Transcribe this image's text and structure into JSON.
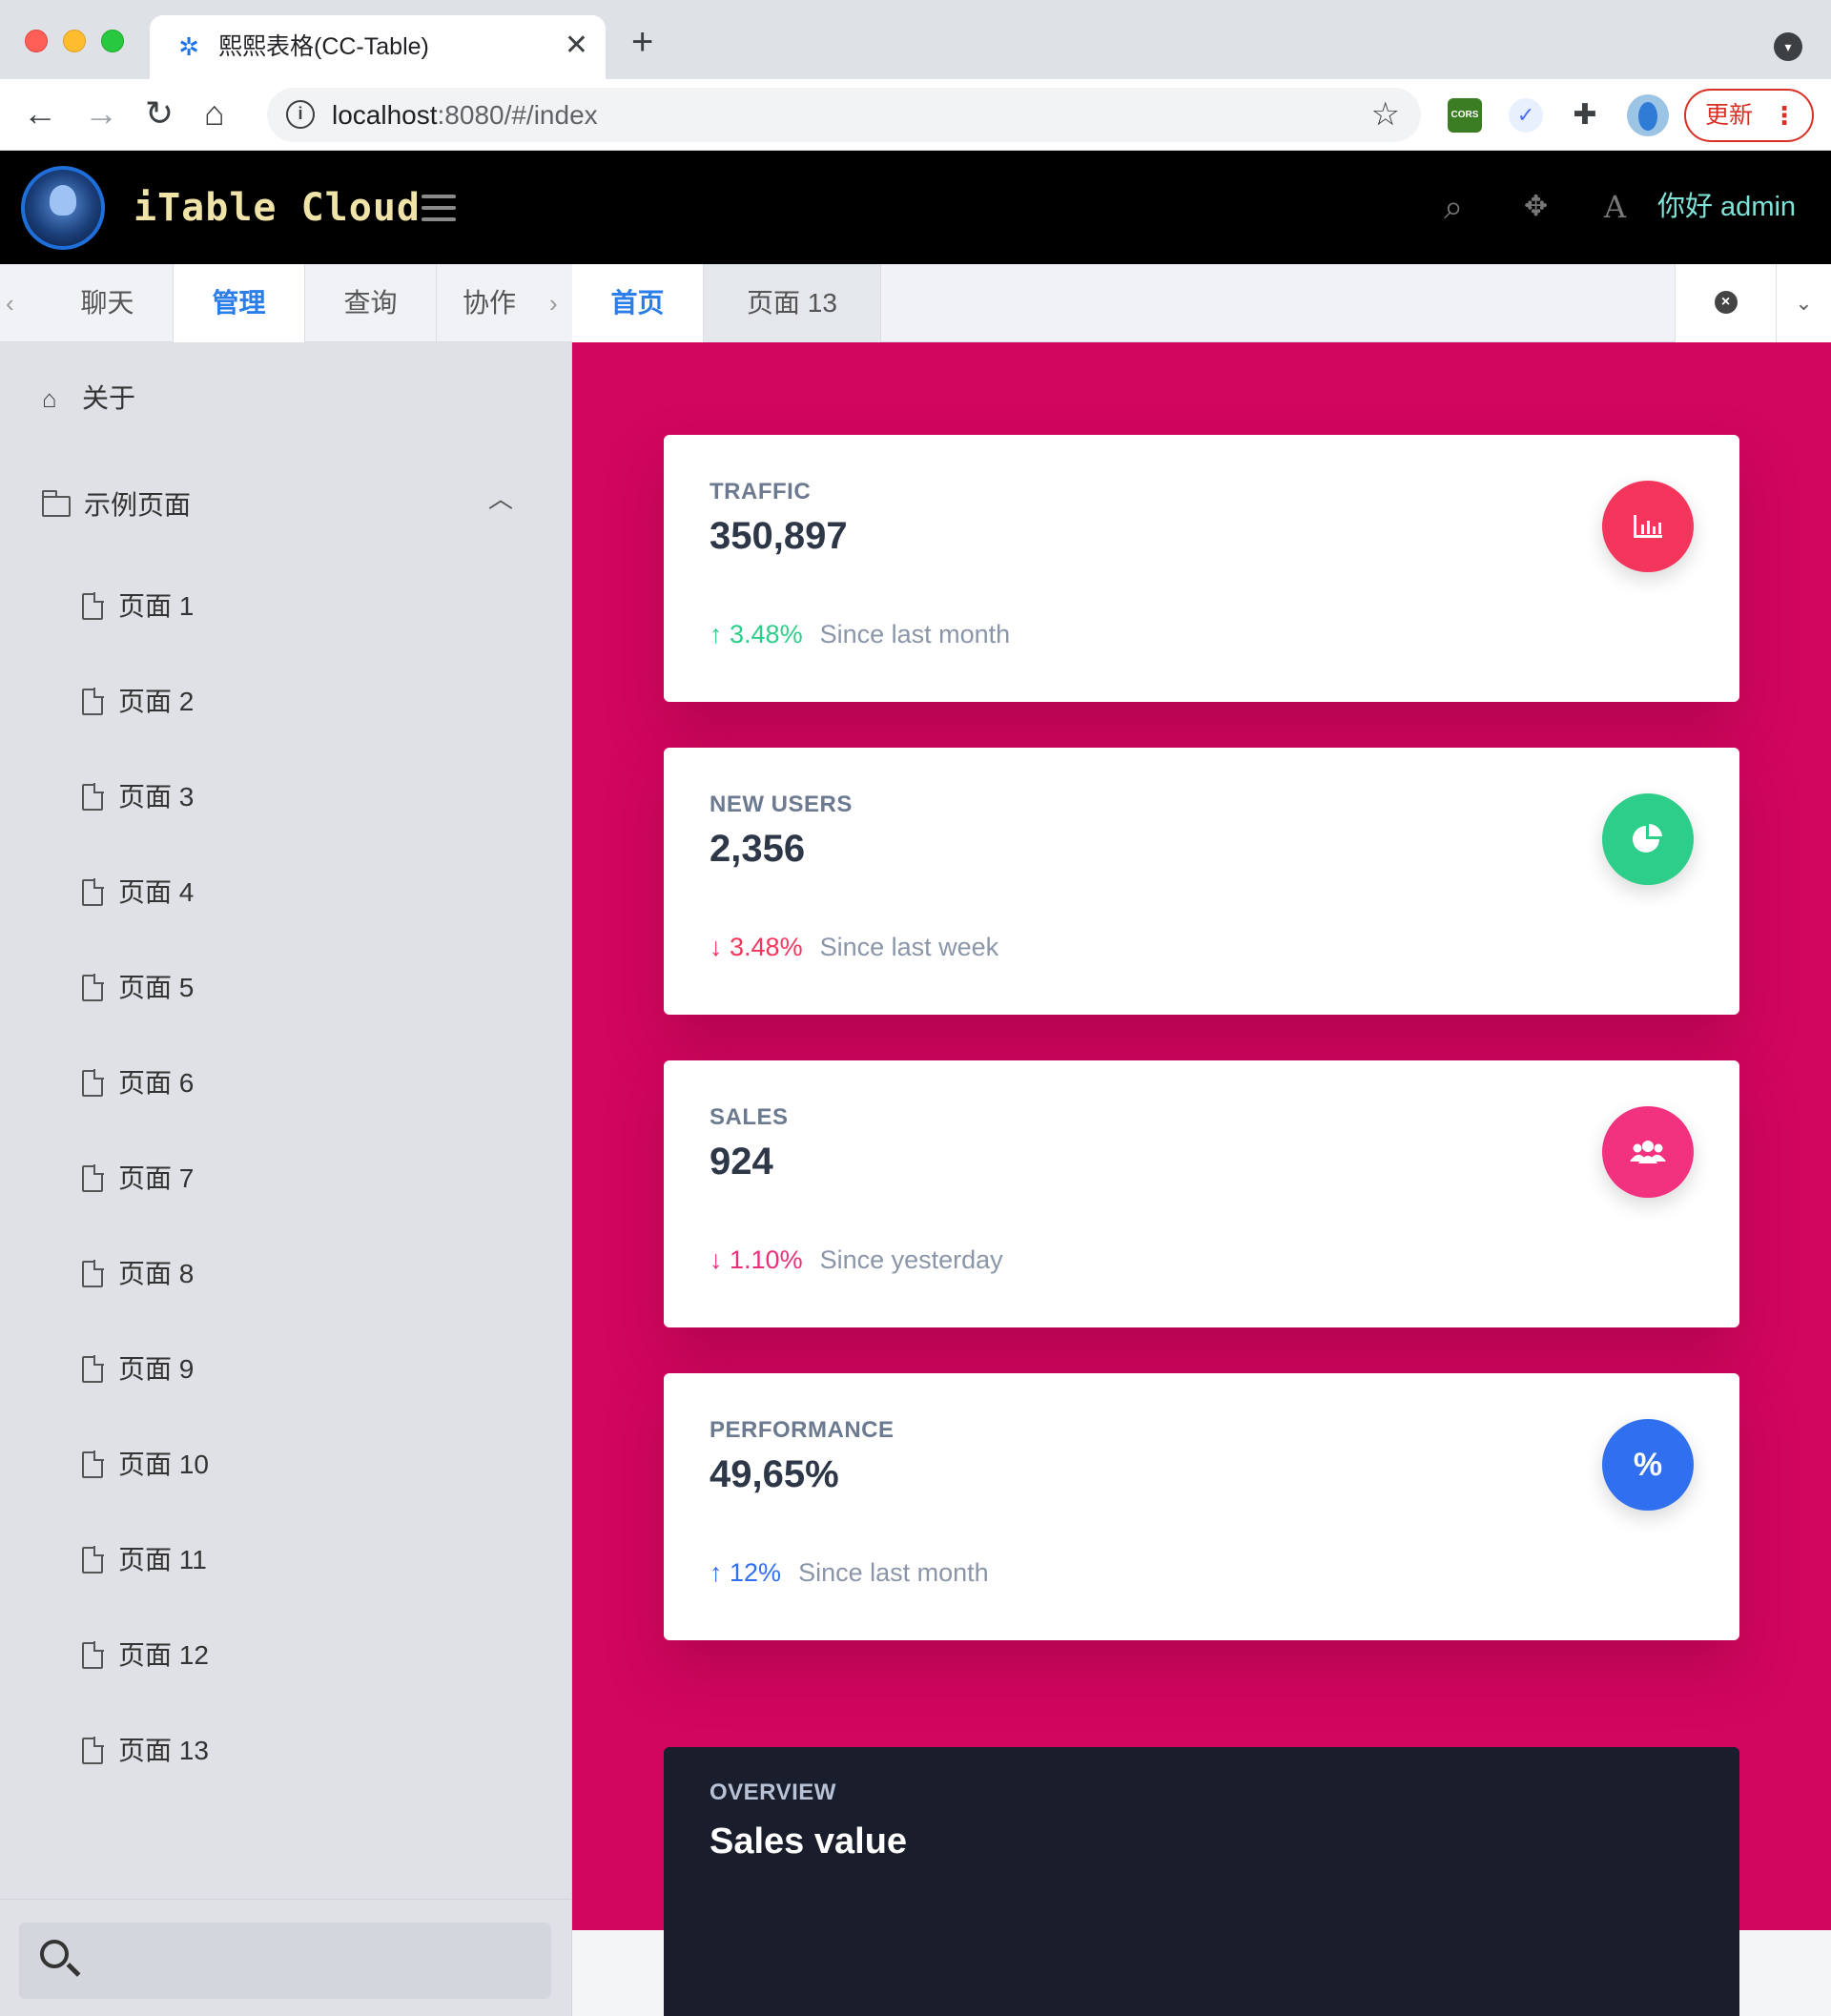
{
  "browser": {
    "tab_title": "熙熙表格(CC-Table)",
    "close_glyph": "✕",
    "new_tab_glyph": "+",
    "url_host": "localhost",
    "url_rest": ":8080/#/index",
    "ext_cors_label": "CORS",
    "update_label": "更新",
    "menu_glyph": "⋮"
  },
  "app": {
    "brand": "iTable Cloud",
    "greeting": "你好 admin",
    "font_icon_label": "A"
  },
  "side_tabs": [
    {
      "label": "聊天"
    },
    {
      "label": "管理"
    },
    {
      "label": "查询"
    },
    {
      "label": "协作"
    }
  ],
  "sidebar": {
    "about": "关于",
    "group": "示例页面",
    "pages": [
      "页面 1",
      "页面 2",
      "页面 3",
      "页面 4",
      "页面 5",
      "页面 6",
      "页面 7",
      "页面 8",
      "页面 9",
      "页面 10",
      "页面 11",
      "页面 12",
      "页面 13"
    ]
  },
  "content_tabs": [
    {
      "label": "首页"
    },
    {
      "label": "页面 13"
    }
  ],
  "cards": [
    {
      "label": "TRAFFIC",
      "value": "350,897",
      "change": "3.48%",
      "direction": "up",
      "since": "Since last month",
      "color": "#2dce89",
      "icon": "chart-bar-icon",
      "icon_bg": "#f5365c"
    },
    {
      "label": "NEW USERS",
      "value": "2,356",
      "change": "3.48%",
      "direction": "down",
      "since": "Since last week",
      "color": "#f5365c",
      "icon": "chart-pie-icon",
      "icon_bg": "#2dce89"
    },
    {
      "label": "SALES",
      "value": "924",
      "change": "1.10%",
      "direction": "down",
      "since": "Since yesterday",
      "color": "#f3a4b5",
      "icon": "users-icon",
      "icon_bg": "#f3327f"
    },
    {
      "label": "PERFORMANCE",
      "value": "49,65%",
      "change": "12%",
      "direction": "up",
      "since": "Since last month",
      "color": "#5e72e4",
      "icon": "percent-icon",
      "icon_bg": "#2f6ff0"
    }
  ],
  "overview": {
    "label": "OVERVIEW",
    "title": "Sales value"
  },
  "colors": {
    "hero_bg": "#d2065f",
    "header_bg": "#000000",
    "active_tab": "#2b7de9"
  }
}
